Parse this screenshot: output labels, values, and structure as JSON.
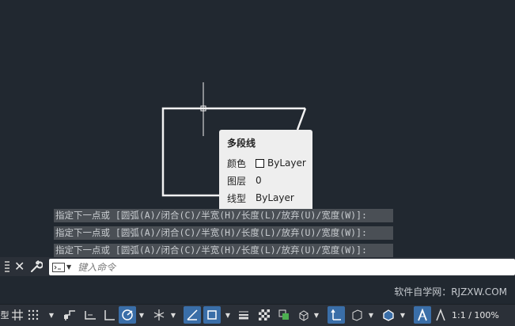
{
  "colors": {
    "canvas": "#212830",
    "active_tool": "#3a6ea8",
    "tooltip_bg": "#eeeeee"
  },
  "tooltip": {
    "title": "多段线",
    "rows": [
      {
        "label": "颜色",
        "value": "ByLayer"
      },
      {
        "label": "图层",
        "value": "0"
      },
      {
        "label": "线型",
        "value": "ByLayer"
      }
    ]
  },
  "history": [
    "指定下一点或 [圆弧(A)/闭合(C)/半宽(H)/长度(L)/放弃(U)/宽度(W)]:",
    "指定下一点或 [圆弧(A)/闭合(C)/半宽(H)/长度(L)/放弃(U)/宽度(W)]:",
    "指定下一点或 [圆弧(A)/闭合(C)/半宽(H)/长度(L)/放弃(U)/宽度(W)]:"
  ],
  "command": {
    "placeholder": "键入命令",
    "value": ""
  },
  "watermark": "软件自学网：RJZXW.COM",
  "status": {
    "model_label": "型",
    "annotation_scale": "1:1 / 100%",
    "icons": [
      "grid-icon",
      "snap-icon",
      "infer-icon",
      "ortho-icon",
      "polar-icon",
      "isodraft-icon",
      "osnap-icon",
      "dyn-ucs-icon",
      "otrack-icon",
      "lineweight-icon",
      "transparency-icon",
      "selection-cycling-icon",
      "3d-osnap-icon",
      "dynamic-ucs-icon",
      "gizmo-icon",
      "annotation-visibility-icon",
      "autoscale-icon",
      "annotation-scale-icon"
    ]
  }
}
